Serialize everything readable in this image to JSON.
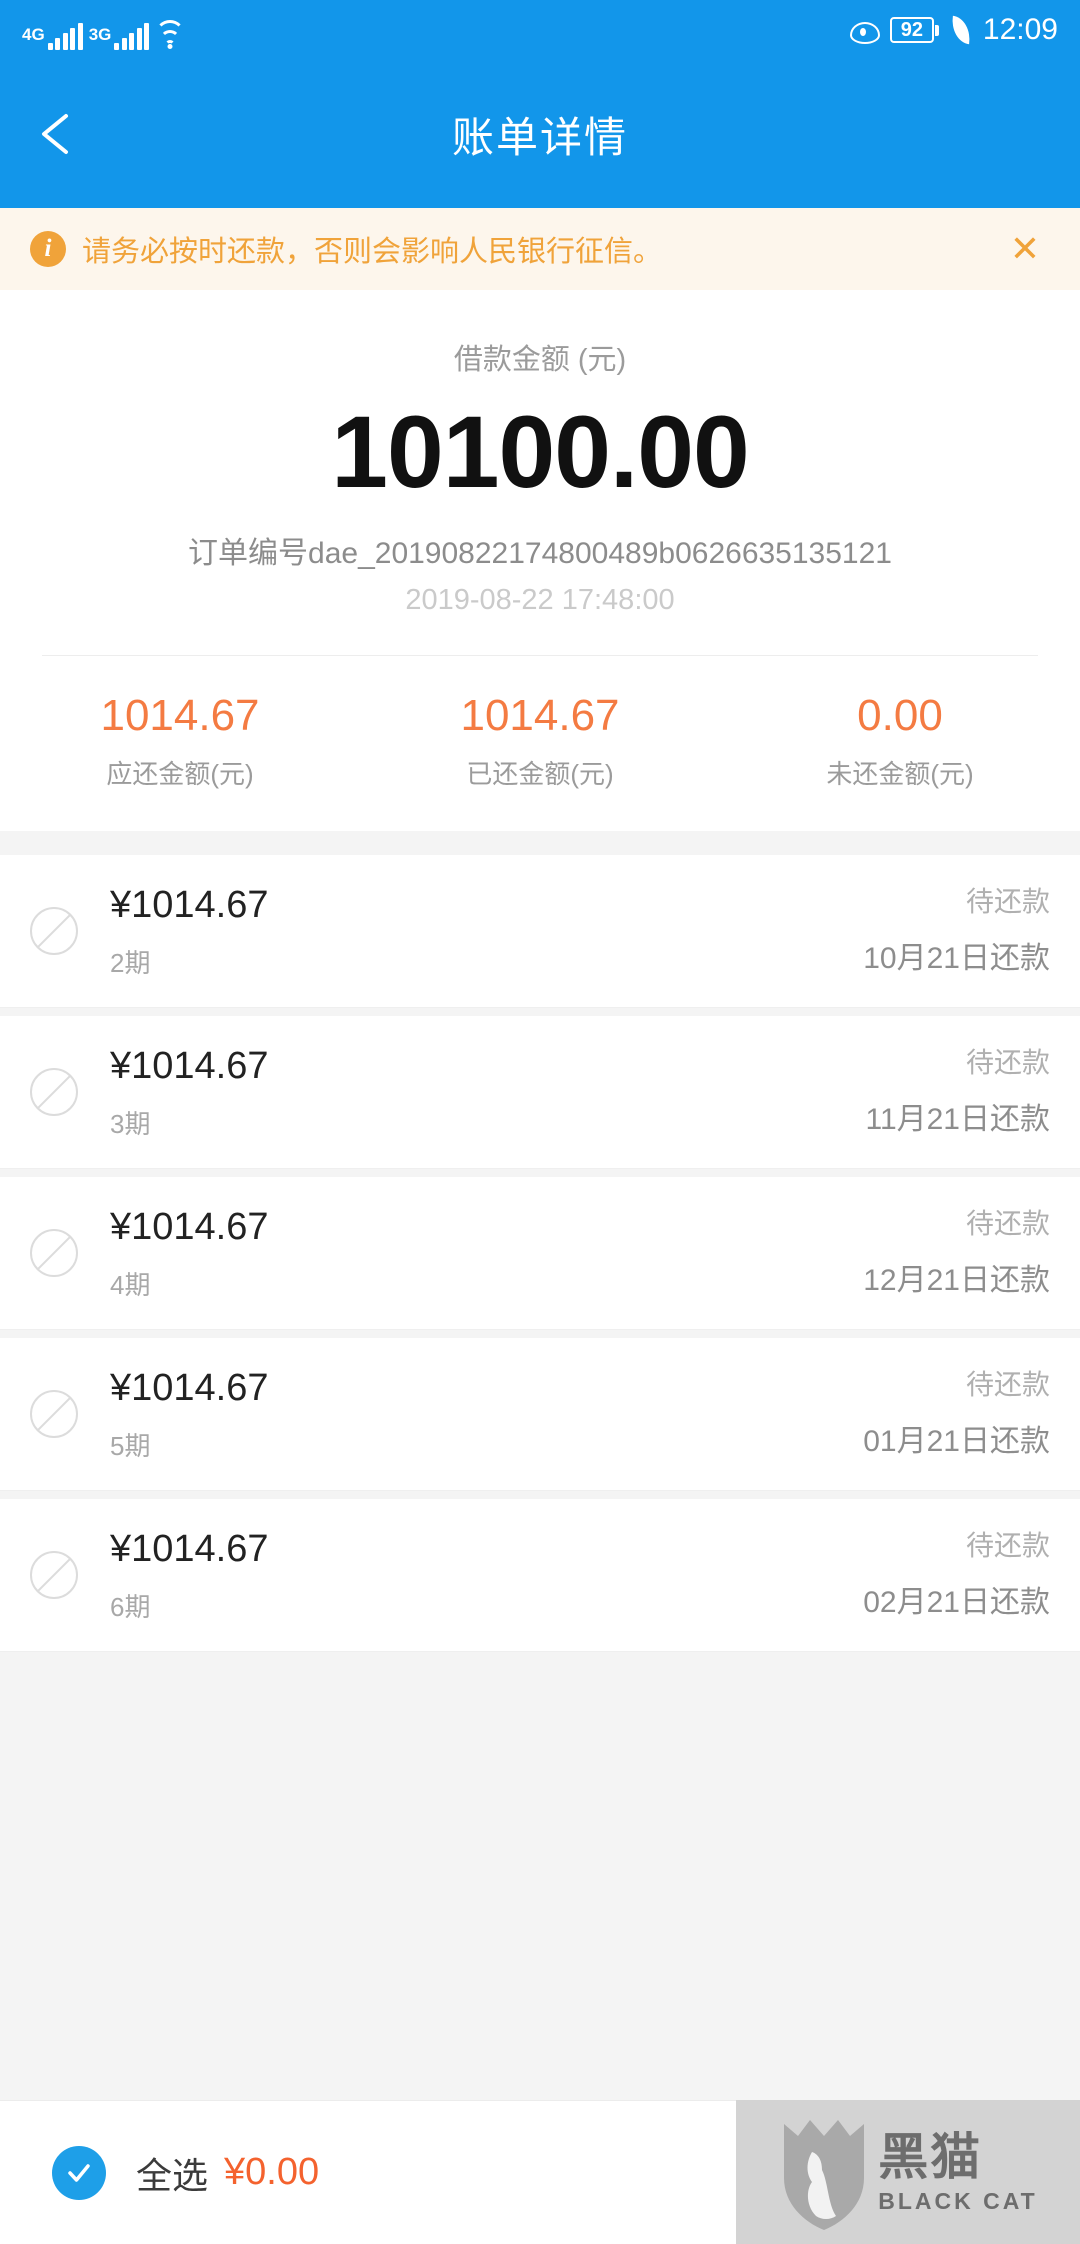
{
  "status_bar": {
    "net_1": "4G",
    "net_2": "3G",
    "wifi_icon": "wifi-icon",
    "eye_icon": "eye-icon",
    "battery_level": "92",
    "leaf_icon": "leaf-icon",
    "time": "12:09"
  },
  "nav": {
    "back_icon": "back-arrow-icon",
    "title": "账单详情"
  },
  "warning": {
    "icon": "info-icon",
    "text": "请务必按时还款，否则会影响人民银行征信。",
    "close": "✕"
  },
  "summary": {
    "amount_label": "借款金额 (元)",
    "amount_value": "10100.00",
    "order_no": "订单编号dae_20190822174800489b0626635135121",
    "order_date": "2019-08-22 17:48:00",
    "stats": [
      {
        "value": "1014.67",
        "label": "应还金额(元)"
      },
      {
        "value": "1014.67",
        "label": "已还金额(元)"
      },
      {
        "value": "0.00",
        "label": "未还金额(元)"
      }
    ]
  },
  "installments": [
    {
      "amount": "¥1014.67",
      "term": "2期",
      "status": "待还款",
      "due": "10月21日还款"
    },
    {
      "amount": "¥1014.67",
      "term": "3期",
      "status": "待还款",
      "due": "11月21日还款"
    },
    {
      "amount": "¥1014.67",
      "term": "4期",
      "status": "待还款",
      "due": "12月21日还款"
    },
    {
      "amount": "¥1014.67",
      "term": "5期",
      "status": "待还款",
      "due": "01月21日还款"
    },
    {
      "amount": "¥1014.67",
      "term": "6期",
      "status": "待还款",
      "due": "02月21日还款"
    }
  ],
  "bottom_bar": {
    "select_all_label": "全选",
    "total_amount": "¥0.00"
  },
  "watermark": {
    "cn": "黑猫",
    "en": "BLACK CAT"
  },
  "colors": {
    "brand_blue": "#1296ea",
    "warning_orange": "#f0a33a",
    "warning_bg": "#fdf6ec",
    "amount_orange": "#f47b42",
    "accent_blue": "#1e9fe8"
  }
}
